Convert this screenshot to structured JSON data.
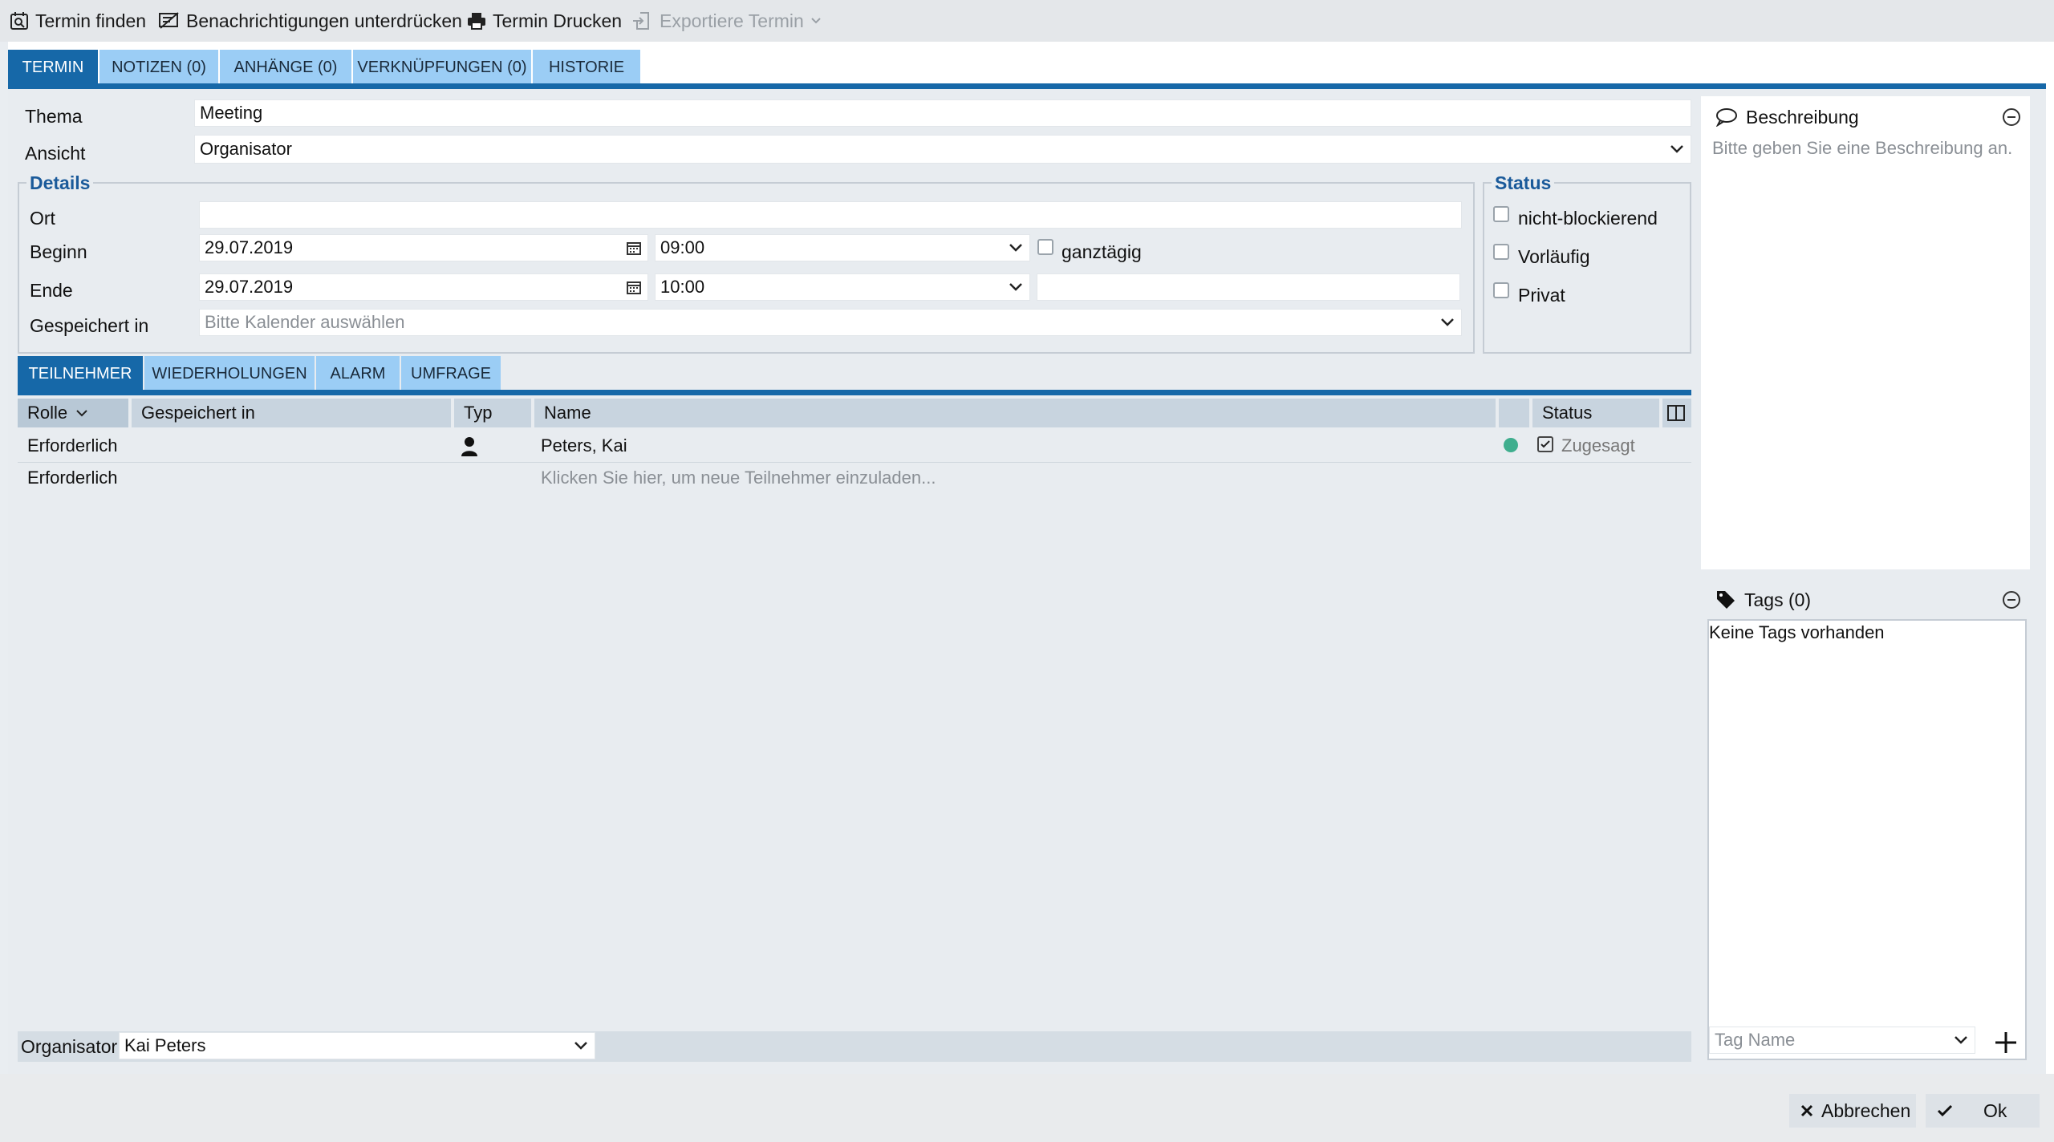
{
  "toolbar": {
    "find_appointment": "Termin finden",
    "suppress_notifications": "Benachrichtigungen unterdrücken",
    "print_appointment": "Termin Drucken",
    "export_appointment": "Exportiere Termin"
  },
  "main_tabs": [
    "TERMIN",
    "NOTIZEN (0)",
    "ANHÄNGE (0)",
    "VERKNÜPFUNGEN (0)",
    "HISTORIE"
  ],
  "form": {
    "subject_label": "Thema",
    "subject_value": "Meeting",
    "view_label": "Ansicht",
    "view_value": "Organisator"
  },
  "details": {
    "legend": "Details",
    "location_label": "Ort",
    "location_value": "",
    "start_label": "Beginn",
    "start_date": "29.07.2019",
    "start_time": "09:00",
    "all_day_label": "ganztägig",
    "end_label": "Ende",
    "end_date": "29.07.2019",
    "end_time": "10:00",
    "saved_in_label": "Gespeichert in",
    "saved_in_placeholder": "Bitte Kalender auswählen"
  },
  "status": {
    "legend": "Status",
    "non_blocking": "nicht-blockierend",
    "tentative": "Vorläufig",
    "private": "Privat"
  },
  "sub_tabs": [
    "TEILNEHMER",
    "WIEDERHOLUNGEN",
    "ALARM",
    "UMFRAGE"
  ],
  "participants": {
    "columns": [
      "Rolle",
      "Gespeichert in",
      "Typ",
      "Name",
      "Status"
    ],
    "rows": [
      {
        "role": "Erforderlich",
        "saved_in": "",
        "name": "Peters, Kai",
        "status": "Zugesagt",
        "status_color": "#3fae8e"
      },
      {
        "role": "Erforderlich",
        "saved_in": "",
        "name": "Klicken Sie hier, um neue Teilnehmer einzuladen..."
      }
    ]
  },
  "organizer": {
    "label": "Organisator",
    "value": "Kai Peters"
  },
  "description": {
    "title": "Beschreibung",
    "placeholder": "Bitte geben Sie eine Beschreibung an."
  },
  "tags": {
    "title": "Tags (0)",
    "empty": "Keine Tags vorhanden",
    "input_placeholder": "Tag Name"
  },
  "footer": {
    "cancel": "Abbrechen",
    "ok": "Ok"
  },
  "colors": {
    "accent": "#1668a8",
    "tab_inactive": "#9bcdf5",
    "accepted_dot": "#3fae8e"
  }
}
